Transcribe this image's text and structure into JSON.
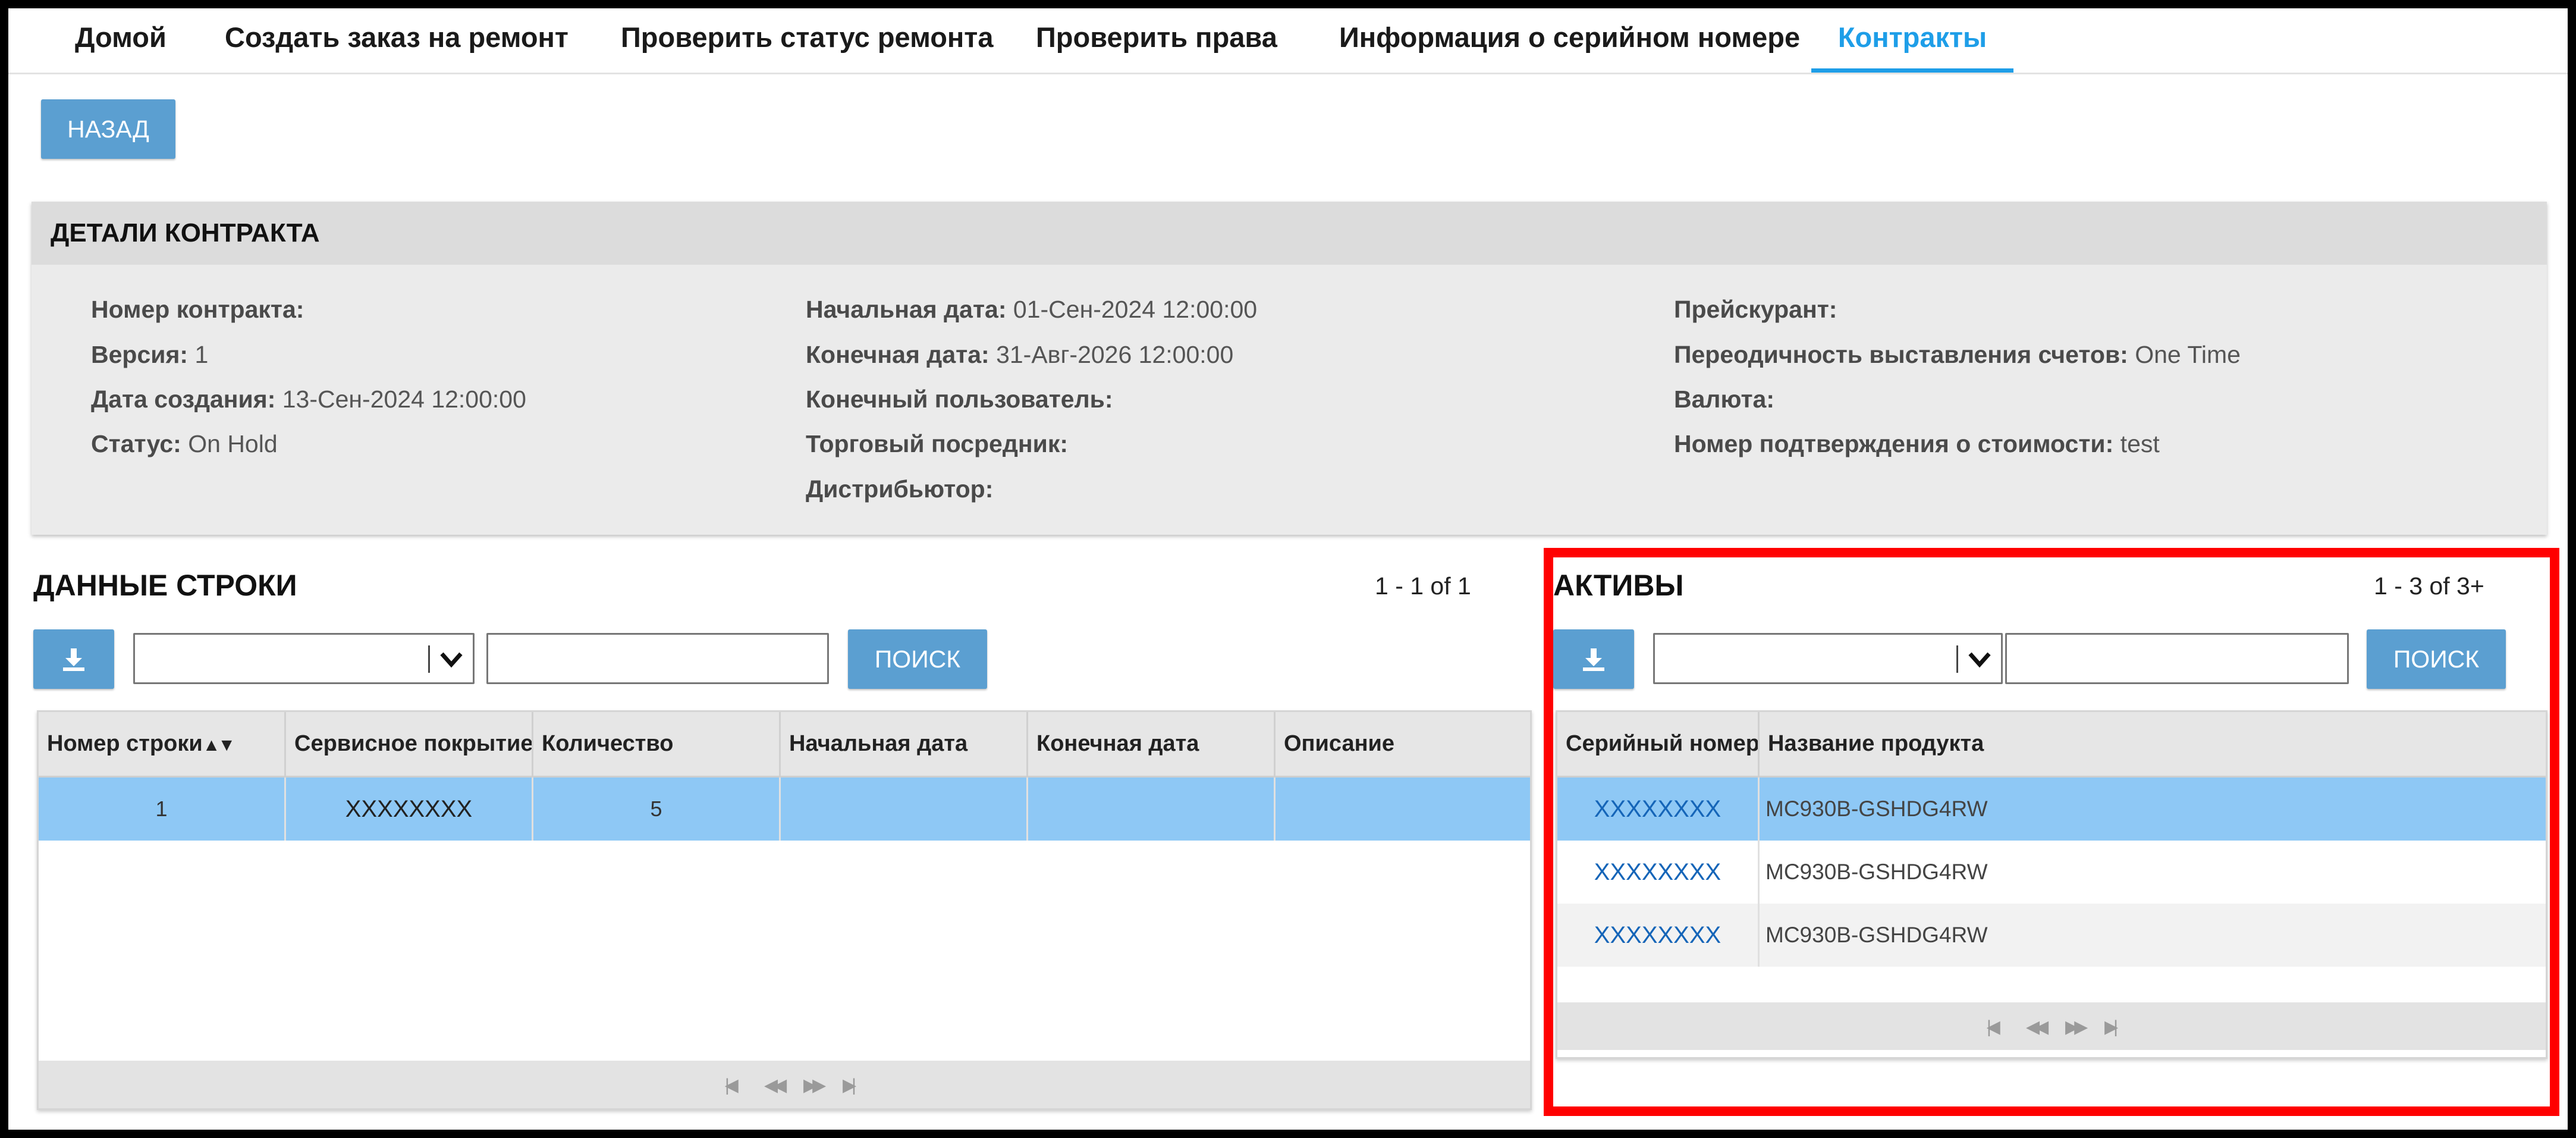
{
  "nav": {
    "tabs": [
      {
        "label": "Домой"
      },
      {
        "label": "Создать заказ на ремонт"
      },
      {
        "label": "Проверить статус ремонта"
      },
      {
        "label": "Проверить права"
      },
      {
        "label": "Информация о серийном номере"
      },
      {
        "label": "Контракты",
        "active": true
      }
    ]
  },
  "back_button": "НАЗАД",
  "details": {
    "title": "ДЕТАЛИ КОНТРАКТА",
    "contract_number": {
      "label": "Номер контракта:",
      "value": ""
    },
    "version": {
      "label": "Версия:",
      "value": "1"
    },
    "created": {
      "label": "Дата создания:",
      "value": "13-Сен-2024 12:00:00"
    },
    "status": {
      "label": "Статус:",
      "value": "On Hold"
    },
    "start_date": {
      "label": "Начальная дата:",
      "value": "01-Сен-2024 12:00:00"
    },
    "end_date": {
      "label": "Конечная дата:",
      "value": "31-Авг-2026 12:00:00"
    },
    "end_user": {
      "label": "Конечный пользователь:",
      "value": ""
    },
    "reseller": {
      "label": "Торговый посредник:",
      "value": ""
    },
    "distributor": {
      "label": "Дистрибьютор:",
      "value": ""
    },
    "price_list": {
      "label": "Прейскурант:",
      "value": ""
    },
    "billing_frequency": {
      "label": "Переодичность выставления счетов:",
      "value": "One Time"
    },
    "currency": {
      "label": "Валюта:",
      "value": ""
    },
    "price_confirmation": {
      "label": "Номер подтверждения о стоимости:",
      "value": "test"
    }
  },
  "lines": {
    "title": "ДАННЫЕ СТРОКИ",
    "counter": "1 - 1 of 1",
    "search_button": "ПОИСК",
    "columns": [
      "Номер строки",
      "Сервисное покрытие",
      "Количество",
      "Начальная дата",
      "Конечная дата",
      "Описание"
    ],
    "sort_glyph": "▲▼",
    "rows": [
      {
        "line": "1",
        "coverage": "XXXXXXXX",
        "qty": "5",
        "start": "",
        "end": "",
        "desc": ""
      }
    ]
  },
  "assets": {
    "title": "АКТИВЫ",
    "counter": "1 - 3 of 3+",
    "search_button": "ПОИСК",
    "columns": [
      "Серийный номер",
      "Название продукта"
    ],
    "rows": [
      {
        "serial": "XXXXXXXX",
        "product": "MC930B-GSHDG4RW"
      },
      {
        "serial": "XXXXXXXX",
        "product": "MC930B-GSHDG4RW"
      },
      {
        "serial": "XXXXXXXX",
        "product": "MC930B-GSHDG4RW"
      }
    ]
  },
  "pager_glyphs": {
    "first": "|◀",
    "prev": "◀◀",
    "next": "▶▶",
    "last": "▶|"
  },
  "colors": {
    "accent": "#1e9ee8",
    "button": "#5b9fd1",
    "selected_row": "#8ec8f5",
    "highlight": "#ff0000"
  }
}
